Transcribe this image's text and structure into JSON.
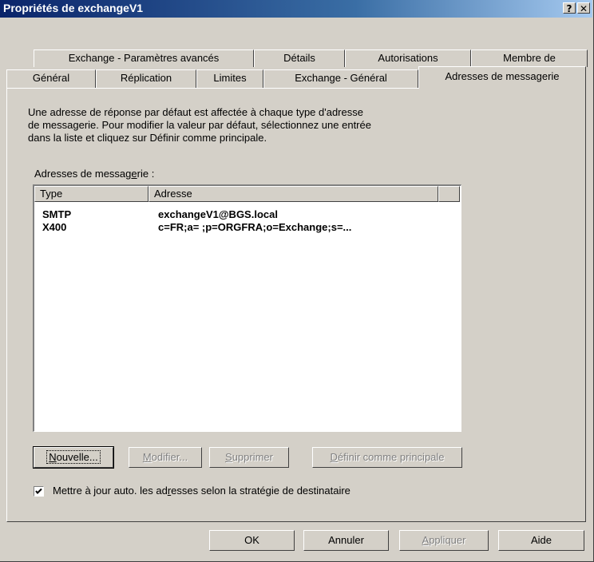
{
  "window": {
    "title": "Propriétés de exchangeV1",
    "help_glyph": "?",
    "close_glyph": "✕"
  },
  "tabs_row1": [
    {
      "label": "Exchange - Paramètres avancés"
    },
    {
      "label": "Détails"
    },
    {
      "label": "Autorisations"
    },
    {
      "label": "Membre de"
    }
  ],
  "tabs_row2": [
    {
      "label": "Général"
    },
    {
      "label": "Réplication"
    },
    {
      "label": "Limites"
    },
    {
      "label": "Exchange - Général"
    },
    {
      "label": "Adresses de messagerie",
      "selected": true
    }
  ],
  "panel": {
    "description_lines": [
      "Une adresse de réponse par défaut est affectée à chaque type d'adresse",
      "de messagerie. Pour modifier la valeur par défaut, sélectionnez une entrée",
      "dans la liste et cliquez sur Définir comme principale."
    ],
    "list_label_pre": "Adresses de messag",
    "list_label_accel": "e",
    "list_label_post": "rie :",
    "columns": [
      "Type",
      "Adresse"
    ],
    "rows": [
      {
        "type": "SMTP",
        "address": "exchangeV1@BGS.local"
      },
      {
        "type": "X400",
        "address": "c=FR;a= ;p=ORGFRA;o=Exchange;s=..."
      }
    ],
    "buttons": {
      "new": {
        "accel": "N",
        "rest": "ouvelle..."
      },
      "modify": {
        "accel": "M",
        "rest": "odifier..."
      },
      "delete": {
        "accel": "S",
        "rest": "upprimer"
      },
      "set_primary": {
        "accel": "D",
        "rest": "éfinir comme principale"
      }
    },
    "checkbox": {
      "checked": true,
      "label_pre": "Mettre à jour auto. les ad",
      "label_accel": "r",
      "label_post": "esses selon la stratégie de destinataire"
    }
  },
  "footer_buttons": {
    "ok": "OK",
    "cancel": "Annuler",
    "apply_accel": "A",
    "apply_rest": "ppliquer",
    "help": "Aide"
  }
}
